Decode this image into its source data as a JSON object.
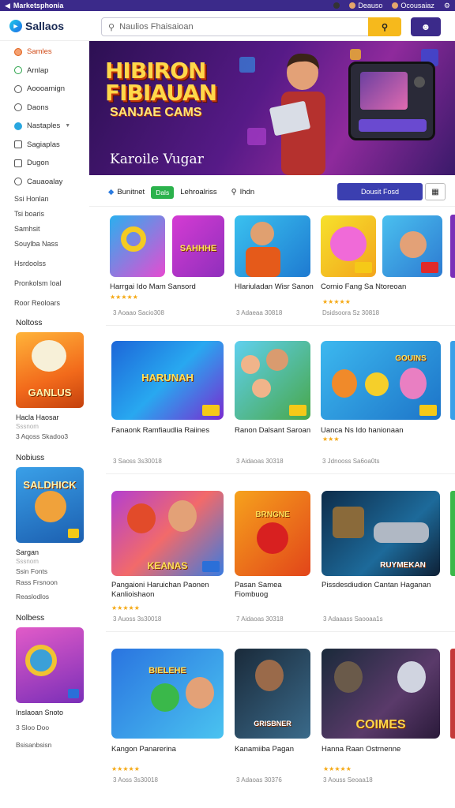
{
  "topbar": {
    "title": "Marketsphonia",
    "chips": [
      "Deauso",
      "Ocousaiaz"
    ]
  },
  "header": {
    "logo": "Sallaos",
    "search_placeholder": "Naulios Fhaisaioan"
  },
  "sidebar": {
    "items": [
      {
        "label": "Samles",
        "icon": "flame-icon"
      },
      {
        "label": "Arnlap",
        "icon": "leaf-icon"
      },
      {
        "label": "Aoooamign",
        "icon": "circle-icon"
      },
      {
        "label": "Daons",
        "icon": "circle-icon"
      },
      {
        "label": "Nastaples",
        "icon": "shield-icon"
      },
      {
        "label": "Sagiaplas",
        "icon": "grid-icon"
      },
      {
        "label": "Dugon",
        "icon": "square-icon"
      },
      {
        "label": "Cauaoalay",
        "icon": "circle-icon"
      }
    ],
    "subitems": [
      "Ssi Honlan",
      "Tsi boaris",
      "Samhsit",
      "Souylba Nass",
      "Hsrdoolss",
      "Pronkolsm Ioal",
      "Roor Reoloars"
    ],
    "sections": [
      {
        "heading": "Noltoss",
        "card_text": "GANLUS",
        "title": "Hacla Haosar",
        "meta": "Sssnom",
        "footer": "3 Aqoss Skadoo3"
      },
      {
        "heading": "Nobiuss",
        "card_text": "SALDHICK",
        "title": "Sargan",
        "meta": "Sssnom",
        "footer2": [
          "Ssin Fonts",
          "Rass Frsnoon",
          "Reaslodlos"
        ]
      },
      {
        "heading": "Nolbess",
        "card_text": "",
        "title": "Inslaoan Snoto",
        "meta": "",
        "footer": "3 Sloo Doo"
      }
    ],
    "bottom": "Bsisanbsisn"
  },
  "hero": {
    "title_line1": "HIBIRON",
    "title_line2": "FIBIAUAN",
    "subtitle": "SANJAE CAMS",
    "caption": "Karoile Vugar"
  },
  "filters": {
    "chip1": "Bunitnet",
    "chip_green": "Dals",
    "chip2": "Lehroalriss",
    "chip3": "Ihdn",
    "primary_btn": "Dousit Fosd"
  },
  "rows": [
    {
      "games": [
        {
          "title": "Harrgai Ido Mam Sansord",
          "stars": "★★★★★",
          "meta": "3 Aoaao Sacio308",
          "label": "SAHHHE"
        },
        {
          "title": "Hlariuladan Wisr Sanon",
          "stars": "",
          "meta": "3 Adaeaa 30818",
          "label": ""
        },
        {
          "title": "Cornio Fang Sa Ntoreoan",
          "stars": "★★★★★",
          "meta": "Dsidsoora Sz 30818",
          "label": ""
        }
      ]
    },
    {
      "games": [
        {
          "title": "Fanaonk Ramfiaudlia Raiines",
          "stars": "",
          "meta": "3 Saoss 3s30018",
          "label": "HARUNAH"
        },
        {
          "title": "Ranon Dalsant Saroan",
          "stars": "",
          "meta": "3 Aidaoas 30318",
          "label": ""
        },
        {
          "title": "Uanca Ns Ido hanionaan",
          "stars": "★★★",
          "meta": "3 Jdnooss Sa6oa0ts",
          "label": "GOUINS"
        }
      ]
    },
    {
      "games": [
        {
          "title": "Pangaioni Haruichan Paonen Kanlioishaon",
          "stars": "★★★★★",
          "meta": "3 Auoss 3s30018",
          "label": "KEANAS"
        },
        {
          "title": "Pasan Samea Fiombuog",
          "stars": "",
          "meta": "7 Aidaoas 30318",
          "label": "BRNGNE"
        },
        {
          "title": "Pissdesdiudion Cantan Haganan",
          "stars": "",
          "meta": "3 Adaaass Saooaa1s",
          "label": "RUYMEKAN"
        }
      ]
    },
    {
      "games": [
        {
          "title": "Kangon Panarerina",
          "stars": "★★★★★",
          "meta": "3 Aoss 3s30018",
          "label": "BIELEHE"
        },
        {
          "title": "Kanamiiba Pagan",
          "stars": "",
          "meta": "3 Adaoas 30376",
          "label": "GRISBNER"
        },
        {
          "title": "Hanna Raan Ostrnenne",
          "stars": "★★★★★",
          "meta": "3 Aouss Seoaa18",
          "label": "COIMES"
        }
      ]
    }
  ]
}
